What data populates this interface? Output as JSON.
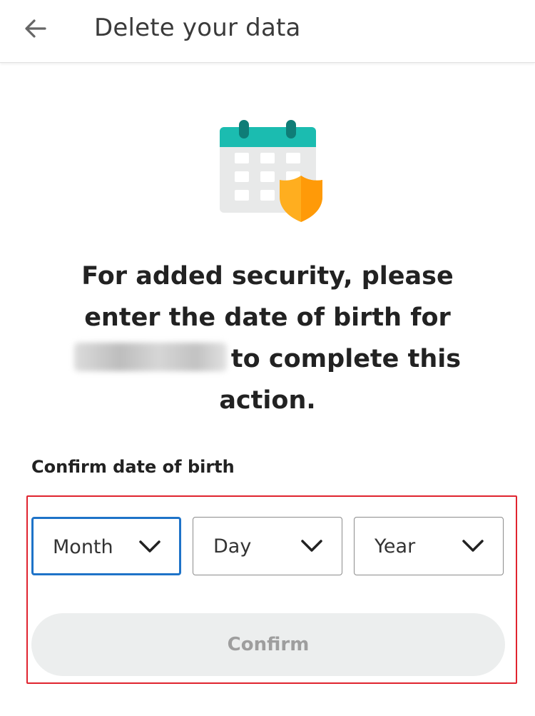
{
  "header": {
    "back_icon": "arrow-left-icon",
    "title": "Delete your data"
  },
  "illustration": {
    "icon": "calendar-shield-icon",
    "colors": {
      "calendar_top": "#1bbcb0",
      "calendar_rings": "#0f7d77",
      "calendar_body": "#e8e9e9",
      "calendar_cells": "#ffffff",
      "shield": "#ffae1f",
      "shield_shade": "#ff8f00"
    }
  },
  "message": {
    "line_start": "For added security, please enter the date of birth for",
    "line_end": "to complete this action."
  },
  "form": {
    "label": "Confirm date of birth",
    "month": {
      "value": "Month",
      "icon": "chevron-down-icon"
    },
    "day": {
      "value": "Day",
      "icon": "chevron-down-icon"
    },
    "year": {
      "value": "Year",
      "icon": "chevron-down-icon"
    },
    "confirm_label": "Confirm"
  },
  "colors": {
    "focus_border": "#1e73c8",
    "highlight_border": "#e0242f",
    "button_disabled_bg": "#eceeee",
    "button_disabled_text": "#9e9e9e"
  }
}
